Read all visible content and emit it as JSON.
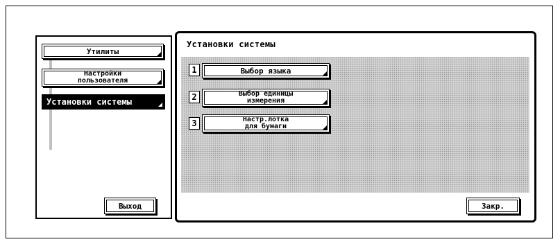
{
  "menu": {
    "utilities_label": "Утилиты",
    "user_settings_label": "Настройки\nпользователя",
    "system_settings_label": "Установки системы",
    "exit_label": "Выход"
  },
  "main": {
    "title": "Установки системы",
    "options": [
      {
        "number": "1",
        "label": "Выбор языка"
      },
      {
        "number": "2",
        "label": "Выбор единицы\nизмерения"
      },
      {
        "number": "3",
        "label": "Настр.лотка\nдля бумаги"
      }
    ],
    "close_label": "Закр."
  },
  "icons": {
    "button_corner": "corner-triangle-icon"
  }
}
